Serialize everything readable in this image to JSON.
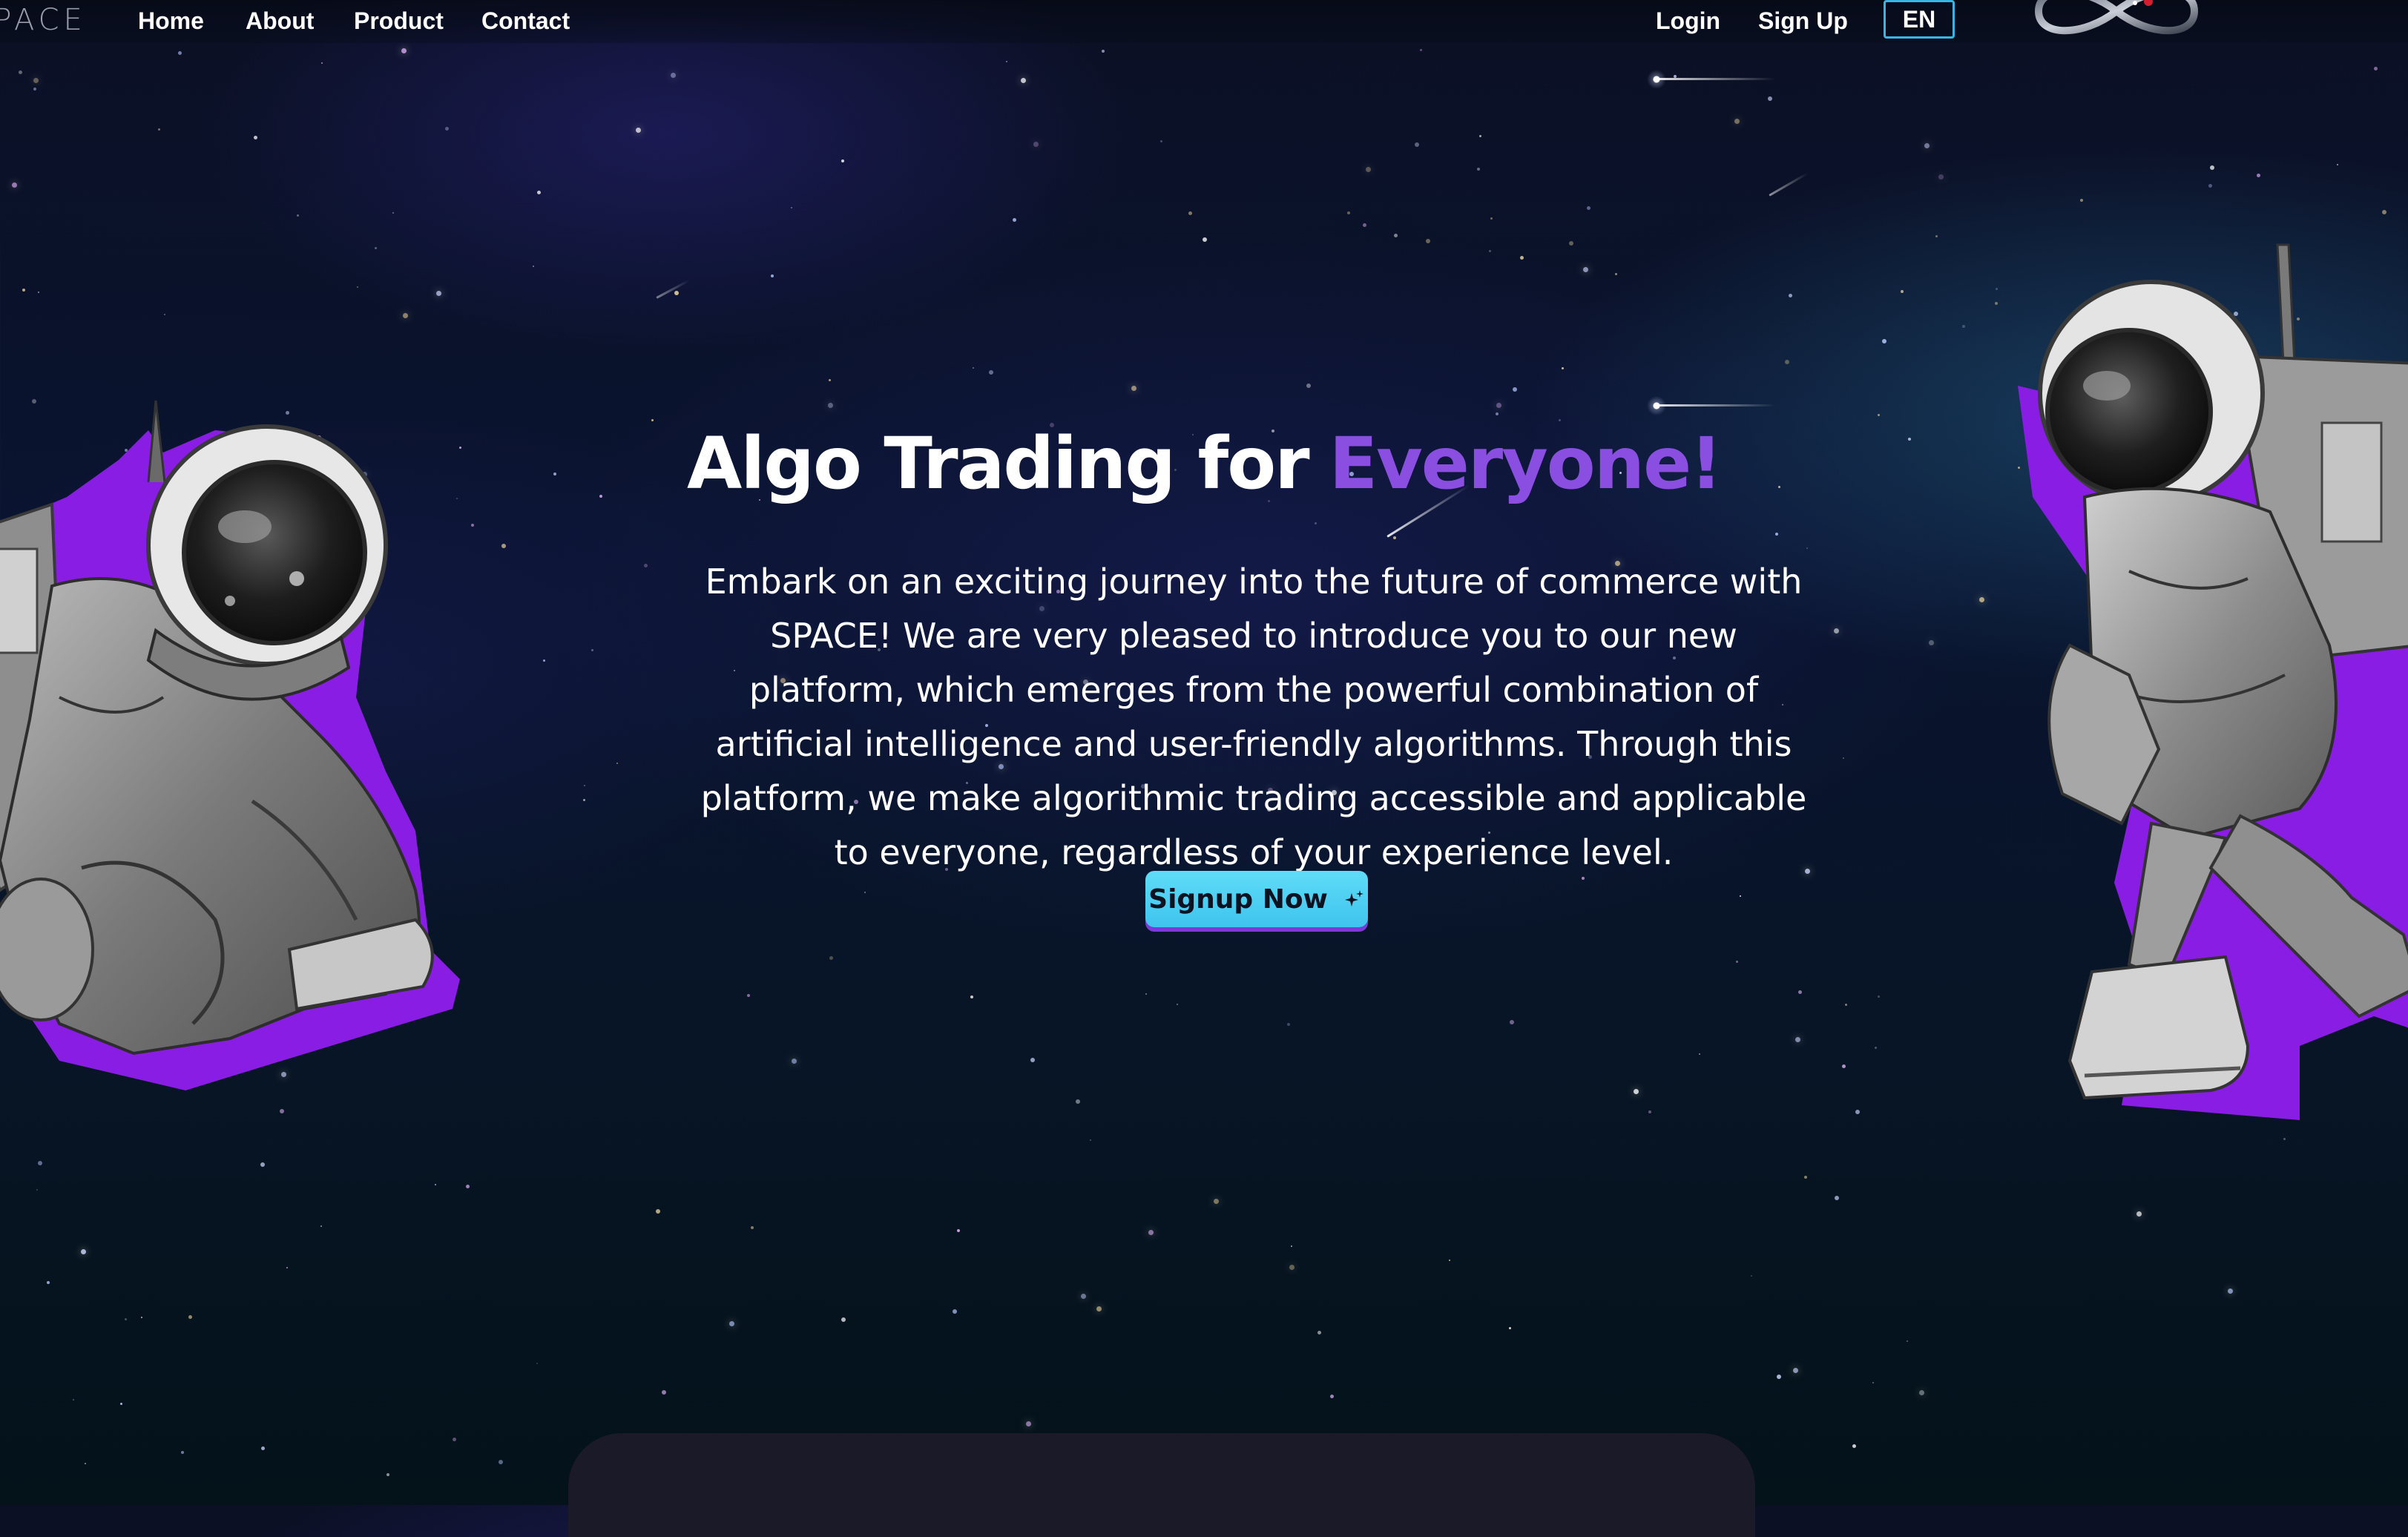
{
  "brand": {
    "name": "SPACE"
  },
  "nav": {
    "links": [
      {
        "label": "Home"
      },
      {
        "label": "About"
      },
      {
        "label": "Product"
      },
      {
        "label": "Contact"
      }
    ],
    "login_label": "Login",
    "signup_label": "Sign Up",
    "language": "EN"
  },
  "hero": {
    "title_main": "Algo Trading for",
    "title_highlight": "Everyone!",
    "description": "Embark on an exciting journey into the future of commerce with SPACE! We are very pleased to introduce you to our new platform, which emerges from the powerful combination of artificial intelligence and user-friendly algorithms. Through this platform, we make algorithmic trading accessible and applicable to everyone, regardless of your experience level.",
    "cta_label": "Signup Now",
    "cta_icon": "sparkle-icon"
  },
  "colors": {
    "accent_purple": "#8a4fe0",
    "cta_cyan": "#4fd0f2",
    "lang_border": "#36b6e0",
    "background": "#071526"
  }
}
